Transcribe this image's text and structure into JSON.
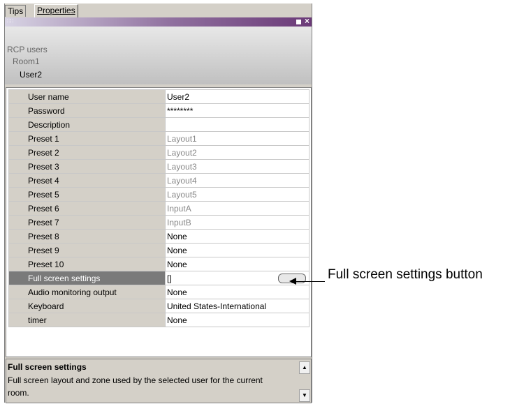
{
  "tabs": {
    "tips": "Tips",
    "properties": "Properties"
  },
  "tree": {
    "root": "RCP users",
    "room": "Room1",
    "user": "User2"
  },
  "properties": [
    {
      "name": "User name",
      "value": "User2"
    },
    {
      "name": "Password",
      "value": "********"
    },
    {
      "name": "Description",
      "value": ""
    },
    {
      "name": "Preset 1",
      "value": "Layout1"
    },
    {
      "name": "Preset 2",
      "value": "Layout2"
    },
    {
      "name": "Preset 3",
      "value": "Layout3"
    },
    {
      "name": "Preset 4",
      "value": "Layout4"
    },
    {
      "name": "Preset 5",
      "value": "Layout5"
    },
    {
      "name": "Preset 6",
      "value": "InputA"
    },
    {
      "name": "Preset 7",
      "value": "InputB"
    },
    {
      "name": "Preset 8",
      "value": "None"
    },
    {
      "name": "Preset 9",
      "value": "None"
    },
    {
      "name": "Preset 10",
      "value": "None"
    },
    {
      "name": "Full screen settings",
      "value": "[]"
    },
    {
      "name": "Audio monitoring output",
      "value": "None"
    },
    {
      "name": "Keyboard",
      "value": "United States-International"
    },
    {
      "name": "timer",
      "value": "None"
    }
  ],
  "help": {
    "title": "Full screen settings",
    "text": "Full screen layout and zone used by the selected user for the current room."
  },
  "callout": {
    "label": "Full screen settings button"
  }
}
